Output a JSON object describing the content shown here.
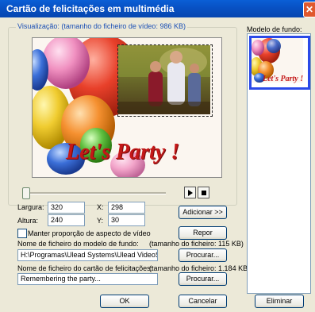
{
  "window": {
    "title": "Cartão de felicitações em multimédia",
    "close_glyph": "✕"
  },
  "preview": {
    "group_label": "Visualização: (tamanho do ficheiro de vídeo: 986 KB)",
    "card_text": "Let's Party !"
  },
  "transport": {
    "play_icon": "play-icon",
    "stop_icon": "stop-icon",
    "position": 0
  },
  "size": {
    "width_label": "Largura:",
    "width_value": "320",
    "height_label": "Altura:",
    "height_value": "240",
    "x_label": "X:",
    "x_value": "298",
    "y_label": "Y:",
    "y_value": "30",
    "add_button": "Adicionar >>",
    "reset_button": "Repor",
    "keep_aspect_label": "Manter proporção de aspecto de vídeo",
    "keep_aspect_checked": false
  },
  "background_file": {
    "label": "Nome de ficheiro do modelo de fundo:",
    "size_text": "(tamanho do ficheiro: 115 KB)",
    "value": "H:\\Programas\\Ulead Systems\\Ulead VideoStu",
    "browse_button": "Procurar..."
  },
  "card_file": {
    "label": "Nome de ficheiro do cartão de felicitações:",
    "size_text": "(tamanho do ficheiro: 1.184 KB)",
    "value": "Remembering the party...",
    "browse_button": "Procurar..."
  },
  "template_panel": {
    "label": "Modelo de fundo:",
    "thumbnail_text": "Let's Party !"
  },
  "footer": {
    "ok_button": "OK",
    "cancel_button": "Cancelar",
    "delete_button": "Eliminar"
  },
  "colors": {
    "title_bar": "#0a5fd6",
    "party_text": "#c41818",
    "selection_border": "#2a49e8"
  }
}
